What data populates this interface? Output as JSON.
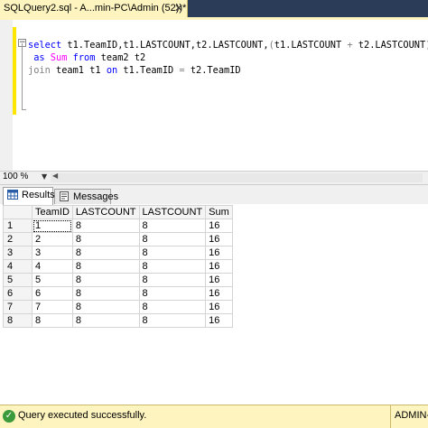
{
  "tab": {
    "title": "SQLQuery2.sql - A...min-PC\\Admin (52))*",
    "close_glyph": "✕"
  },
  "editor": {
    "line1": {
      "select": "select",
      "cols": " t1.TeamID,t1.LASTCOUNT,t2.LASTCOUNT,",
      "paren": "(",
      "expr1": "t1.LASTCOUNT",
      "plus": " + ",
      "expr2": "t2.LASTCOUNT",
      "close": ")"
    },
    "line2": {
      "as": " as",
      "alias": " Sum",
      "from": " from",
      "rest": " team2 t2"
    },
    "line3": {
      "join": "join",
      "rest1": " team1 t1 ",
      "on": "on",
      "rest2": " t1.TeamID ",
      "eq": "=",
      "rest3": " t2.TeamID"
    }
  },
  "zoom": {
    "level": "100 %"
  },
  "result_tabs": [
    {
      "label": "Results",
      "icon": "grid-icon"
    },
    {
      "label": "Messages",
      "icon": "messages-icon"
    }
  ],
  "grid": {
    "columns": [
      "TeamID",
      "LASTCOUNT",
      "LASTCOUNT",
      "Sum"
    ],
    "rows": [
      {
        "n": "1",
        "cells": [
          "1",
          "8",
          "8",
          "16"
        ]
      },
      {
        "n": "2",
        "cells": [
          "2",
          "8",
          "8",
          "16"
        ]
      },
      {
        "n": "3",
        "cells": [
          "3",
          "8",
          "8",
          "16"
        ]
      },
      {
        "n": "4",
        "cells": [
          "4",
          "8",
          "8",
          "16"
        ]
      },
      {
        "n": "5",
        "cells": [
          "5",
          "8",
          "8",
          "16"
        ]
      },
      {
        "n": "6",
        "cells": [
          "6",
          "8",
          "8",
          "16"
        ]
      },
      {
        "n": "7",
        "cells": [
          "7",
          "8",
          "8",
          "16"
        ]
      },
      {
        "n": "8",
        "cells": [
          "8",
          "8",
          "8",
          "16"
        ]
      }
    ]
  },
  "status": {
    "message": "Query executed successfully.",
    "user": "ADMIN-",
    "colors": {
      "bar": "#fdf4bf",
      "ok": "#3b9a3b"
    }
  }
}
